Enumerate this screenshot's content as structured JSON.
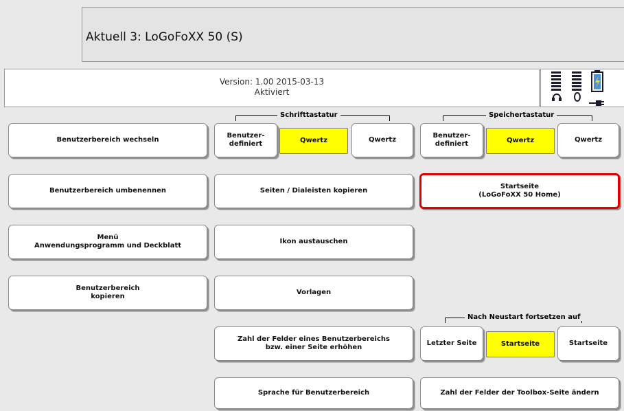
{
  "header": {
    "title": "Aktuell 3: LoGoFoXX 50 (S)"
  },
  "version": {
    "line1": "Version: 1.00 2015-03-13",
    "line2": "Aktiviert"
  },
  "status": {
    "icons": [
      "headphones-icon",
      "speaker-icon",
      "plug-icon",
      "battery-icon"
    ]
  },
  "groups": {
    "schrift": "Schrifttastatur",
    "speicher": "Speichertastatur",
    "neustart": "Nach Neustart fortsetzen auf"
  },
  "buttons": {
    "benutzerbereich_wechseln": "Benutzerbereich wechseln",
    "schrift_benutzer": "Benutzer-\ndefiniert",
    "schrift_qwertz_sel": "Qwertz",
    "schrift_qwertz": "Qwertz",
    "speicher_benutzer": "Benutzer-\ndefiniert",
    "speicher_qwertz_sel": "Qwertz",
    "speicher_qwertz": "Qwertz",
    "benutzerbereich_umbenennen": "Benutzerbereich umbenennen",
    "seiten_kopieren": "Seiten / Dialeisten kopieren",
    "startseite_home": "Startseite\n(LoGoFoXX 50 Home)",
    "menue": "Menü\nAnwendungsprogramm und Deckblatt",
    "ikon_austauschen": "Ikon austauschen",
    "benutzerbereich_kopieren": "Benutzerbereich\nkopieren",
    "vorlagen": "Vorlagen",
    "zahl_felder_erhoehen": "Zahl der Felder eines Benutzerbereichs\nbzw. einer Seite erhöhen",
    "letzter_seite": "Letzter Seite",
    "startseite_sel": "Startseite",
    "startseite": "Startseite",
    "sprache": "Sprache für Benutzerbereich",
    "zahl_toolbox": "Zahl der Felder der Toolbox-Seite ändern"
  },
  "colors": {
    "selected": "#ffff00",
    "highlight": "#e00000"
  }
}
